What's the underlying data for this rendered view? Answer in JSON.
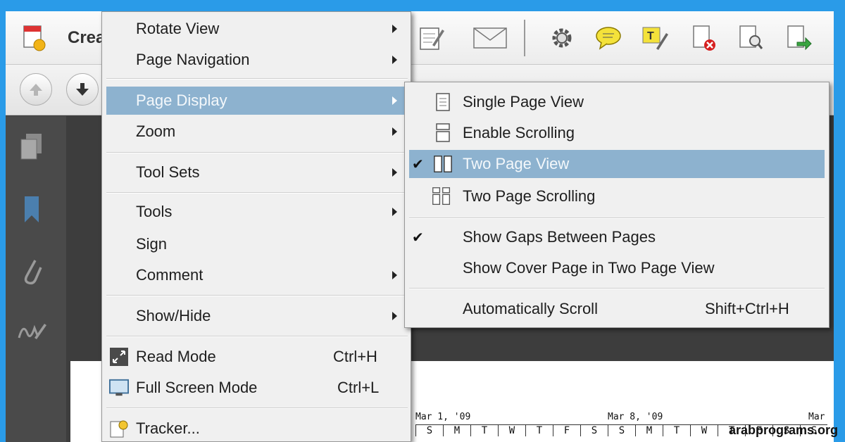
{
  "window": {
    "title_partial": "Crea"
  },
  "view_menu": {
    "items": [
      {
        "label": "Rotate View",
        "has_submenu": true
      },
      {
        "label": "Page Navigation",
        "has_submenu": true
      },
      {
        "label": "Page Display",
        "has_submenu": true,
        "highlighted": true
      },
      {
        "label": "Zoom",
        "has_submenu": true
      },
      {
        "label": "Tool Sets",
        "has_submenu": true
      },
      {
        "label": "Tools",
        "has_submenu": true
      },
      {
        "label": "Sign",
        "has_submenu": false
      },
      {
        "label": "Comment",
        "has_submenu": true
      },
      {
        "label": "Show/Hide",
        "has_submenu": true
      },
      {
        "label": "Read Mode",
        "shortcut": "Ctrl+H",
        "icon": "read-mode-icon"
      },
      {
        "label": "Full Screen Mode",
        "shortcut": "Ctrl+L",
        "icon": "full-screen-icon"
      },
      {
        "label": "Tracker...",
        "icon": "tracker-icon"
      }
    ]
  },
  "page_display_submenu": {
    "items": [
      {
        "label": "Single Page View",
        "icon": "single-page-icon",
        "checked": false
      },
      {
        "label": "Enable Scrolling",
        "icon": "scrolling-icon",
        "checked": false
      },
      {
        "label": "Two Page View",
        "icon": "two-page-icon",
        "checked": true,
        "highlighted": true
      },
      {
        "label": "Two Page Scrolling",
        "icon": "two-page-scrolling-icon",
        "checked": false
      },
      {
        "label": "Show Gaps Between Pages",
        "checked": true
      },
      {
        "label": "Show Cover Page in Two Page View",
        "checked": false
      },
      {
        "label": "Automatically Scroll",
        "shortcut": "Shift+Ctrl+H",
        "checked": false
      }
    ],
    "check_glyph": "✔"
  },
  "calendar": {
    "weeks": [
      "Mar 1, '09",
      "Mar 8, '09",
      "Mar"
    ],
    "days": [
      "S",
      "M",
      "T",
      "W",
      "T",
      "F",
      "S",
      "S",
      "M",
      "T",
      "W",
      "T",
      "F",
      "S",
      "S"
    ]
  },
  "watermark": "arabprograms.org",
  "colors": {
    "highlight": "#8db2cf",
    "menu_bg": "#f0f0f0",
    "frame_border": "#2a9be8"
  }
}
